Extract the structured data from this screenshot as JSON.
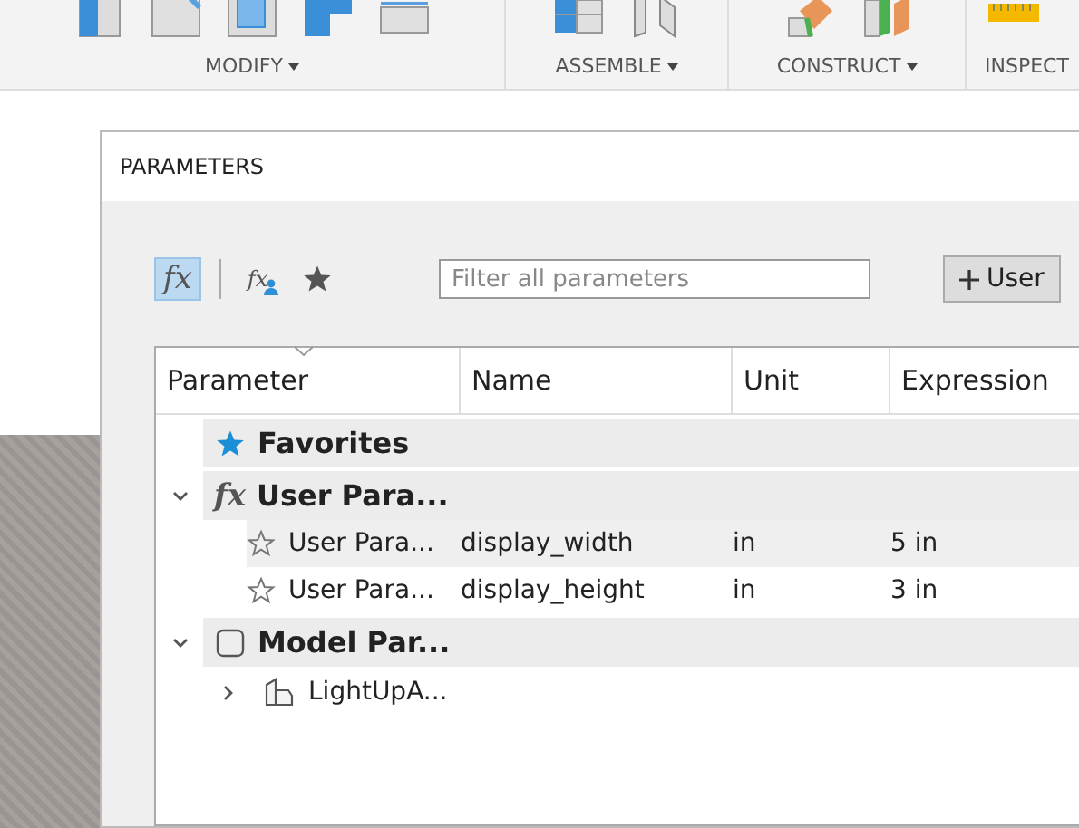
{
  "ribbon": {
    "groups": [
      {
        "label": "MODIFY",
        "icons": [
          {
            "kind": "solid"
          },
          {
            "kind": "box"
          },
          {
            "kind": "shell"
          },
          {
            "kind": "combine"
          },
          {
            "kind": "stack"
          }
        ]
      },
      {
        "label": "ASSEMBLE",
        "icons": [
          {
            "kind": "joint"
          },
          {
            "kind": "panel"
          }
        ]
      },
      {
        "label": "CONSTRUCT",
        "icons": [
          {
            "kind": "plane-orange"
          },
          {
            "kind": "plane-green"
          }
        ]
      },
      {
        "label": "INSPECT",
        "icons": [
          {
            "kind": "ruler"
          }
        ]
      }
    ]
  },
  "dialog": {
    "title": "PARAMETERS",
    "filters": [
      {
        "kind": "fx",
        "label": "fx",
        "selected": true
      },
      {
        "kind": "fx-user",
        "label": "fx",
        "selected": false
      },
      {
        "kind": "star",
        "selected": false
      }
    ],
    "search": {
      "placeholder": "Filter all parameters"
    },
    "add_button": {
      "label": "User"
    },
    "columns": [
      "Parameter",
      "Name",
      "Unit",
      "Expression"
    ],
    "tree": [
      {
        "kind": "favorites",
        "label": "Favorites"
      },
      {
        "kind": "user",
        "icon_label": "fx",
        "label": "User Para...",
        "expanded": true,
        "children": [
          {
            "parameter": "User Para...",
            "name": "display_width",
            "unit": "in",
            "expression": "5 in",
            "favorite": false,
            "selected": true
          },
          {
            "parameter": "User Para...",
            "name": "display_height",
            "unit": "in",
            "expression": "3 in",
            "favorite": false,
            "selected": false
          }
        ]
      },
      {
        "kind": "model",
        "label": "Model Par...",
        "expanded": true,
        "children": [
          {
            "label": "LightUpA...",
            "expanded": false
          }
        ]
      }
    ]
  }
}
